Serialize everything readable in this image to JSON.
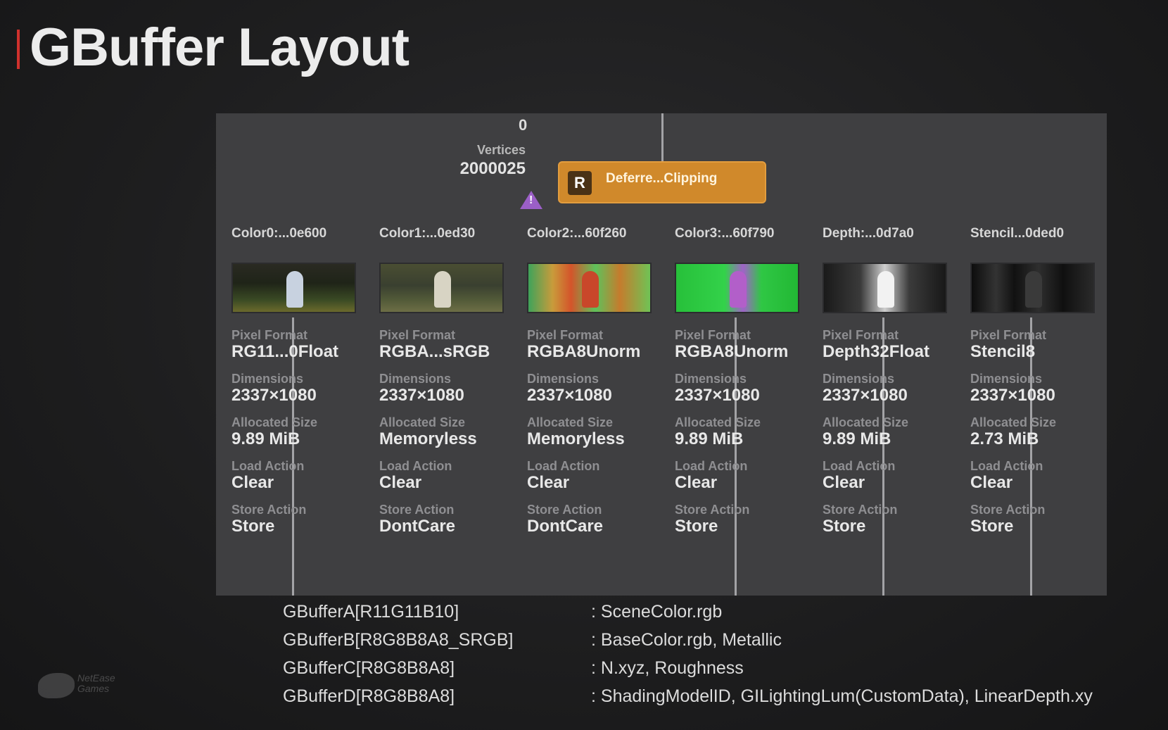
{
  "slide": {
    "title": "GBuffer Layout"
  },
  "capture": {
    "zero_label": "0",
    "vertices_label": "Vertices",
    "vertices_value": "2000025",
    "render_pass": {
      "badge": "R",
      "name": "Deferre...Clipping"
    },
    "attachments": [
      {
        "name": "Color0:...0e600",
        "pixel_format_label": "Pixel Format",
        "pixel_format": "RG11...0Float",
        "dimensions_label": "Dimensions",
        "dimensions": "2337×1080",
        "allocated_size_label": "Allocated Size",
        "allocated_size": "9.89 MiB",
        "load_action_label": "Load Action",
        "load_action": "Clear",
        "store_action_label": "Store Action",
        "store_action": "Store"
      },
      {
        "name": "Color1:...0ed30",
        "pixel_format_label": "Pixel Format",
        "pixel_format": "RGBA...sRGB",
        "dimensions_label": "Dimensions",
        "dimensions": "2337×1080",
        "allocated_size_label": "Allocated Size",
        "allocated_size": "Memoryless",
        "load_action_label": "Load Action",
        "load_action": "Clear",
        "store_action_label": "Store Action",
        "store_action": "DontCare"
      },
      {
        "name": "Color2:...60f260",
        "pixel_format_label": "Pixel Format",
        "pixel_format": "RGBA8Unorm",
        "dimensions_label": "Dimensions",
        "dimensions": "2337×1080",
        "allocated_size_label": "Allocated Size",
        "allocated_size": "Memoryless",
        "load_action_label": "Load Action",
        "load_action": "Clear",
        "store_action_label": "Store Action",
        "store_action": "DontCare"
      },
      {
        "name": "Color3:...60f790",
        "pixel_format_label": "Pixel Format",
        "pixel_format": "RGBA8Unorm",
        "dimensions_label": "Dimensions",
        "dimensions": "2337×1080",
        "allocated_size_label": "Allocated Size",
        "allocated_size": "9.89 MiB",
        "load_action_label": "Load Action",
        "load_action": "Clear",
        "store_action_label": "Store Action",
        "store_action": "Store"
      },
      {
        "name": "Depth:...0d7a0",
        "pixel_format_label": "Pixel Format",
        "pixel_format": "Depth32Float",
        "dimensions_label": "Dimensions",
        "dimensions": "2337×1080",
        "allocated_size_label": "Allocated Size",
        "allocated_size": "9.89 MiB",
        "load_action_label": "Load Action",
        "load_action": "Clear",
        "store_action_label": "Store Action",
        "store_action": "Store"
      },
      {
        "name": "Stencil...0ded0",
        "pixel_format_label": "Pixel Format",
        "pixel_format": "Stencil8",
        "dimensions_label": "Dimensions",
        "dimensions": "2337×1080",
        "allocated_size_label": "Allocated Size",
        "allocated_size": "2.73 MiB",
        "load_action_label": "Load Action",
        "load_action": "Clear",
        "store_action_label": "Store Action",
        "store_action": "Store"
      }
    ]
  },
  "legend": [
    {
      "buffer": "GBufferA[R11G11B10]",
      "content": ": SceneColor.rgb"
    },
    {
      "buffer": "GBufferB[R8G8B8A8_SRGB]",
      "content": ": BaseColor.rgb, Metallic"
    },
    {
      "buffer": "GBufferC[R8G8B8A8]",
      "content": ": N.xyz, Roughness"
    },
    {
      "buffer": "GBufferD[R8G8B8A8]",
      "content": ": ShadingModelID, GILightingLum(CustomData), LinearDepth.xy"
    }
  ],
  "logo": {
    "icon": "netease-games-logo",
    "line1": "NetEase",
    "line2": "Games"
  },
  "colors": {
    "accent": "#d0312d",
    "panel": "#3f3f41",
    "render_pass": "#d0892b",
    "warning": "#9b5fc7"
  }
}
